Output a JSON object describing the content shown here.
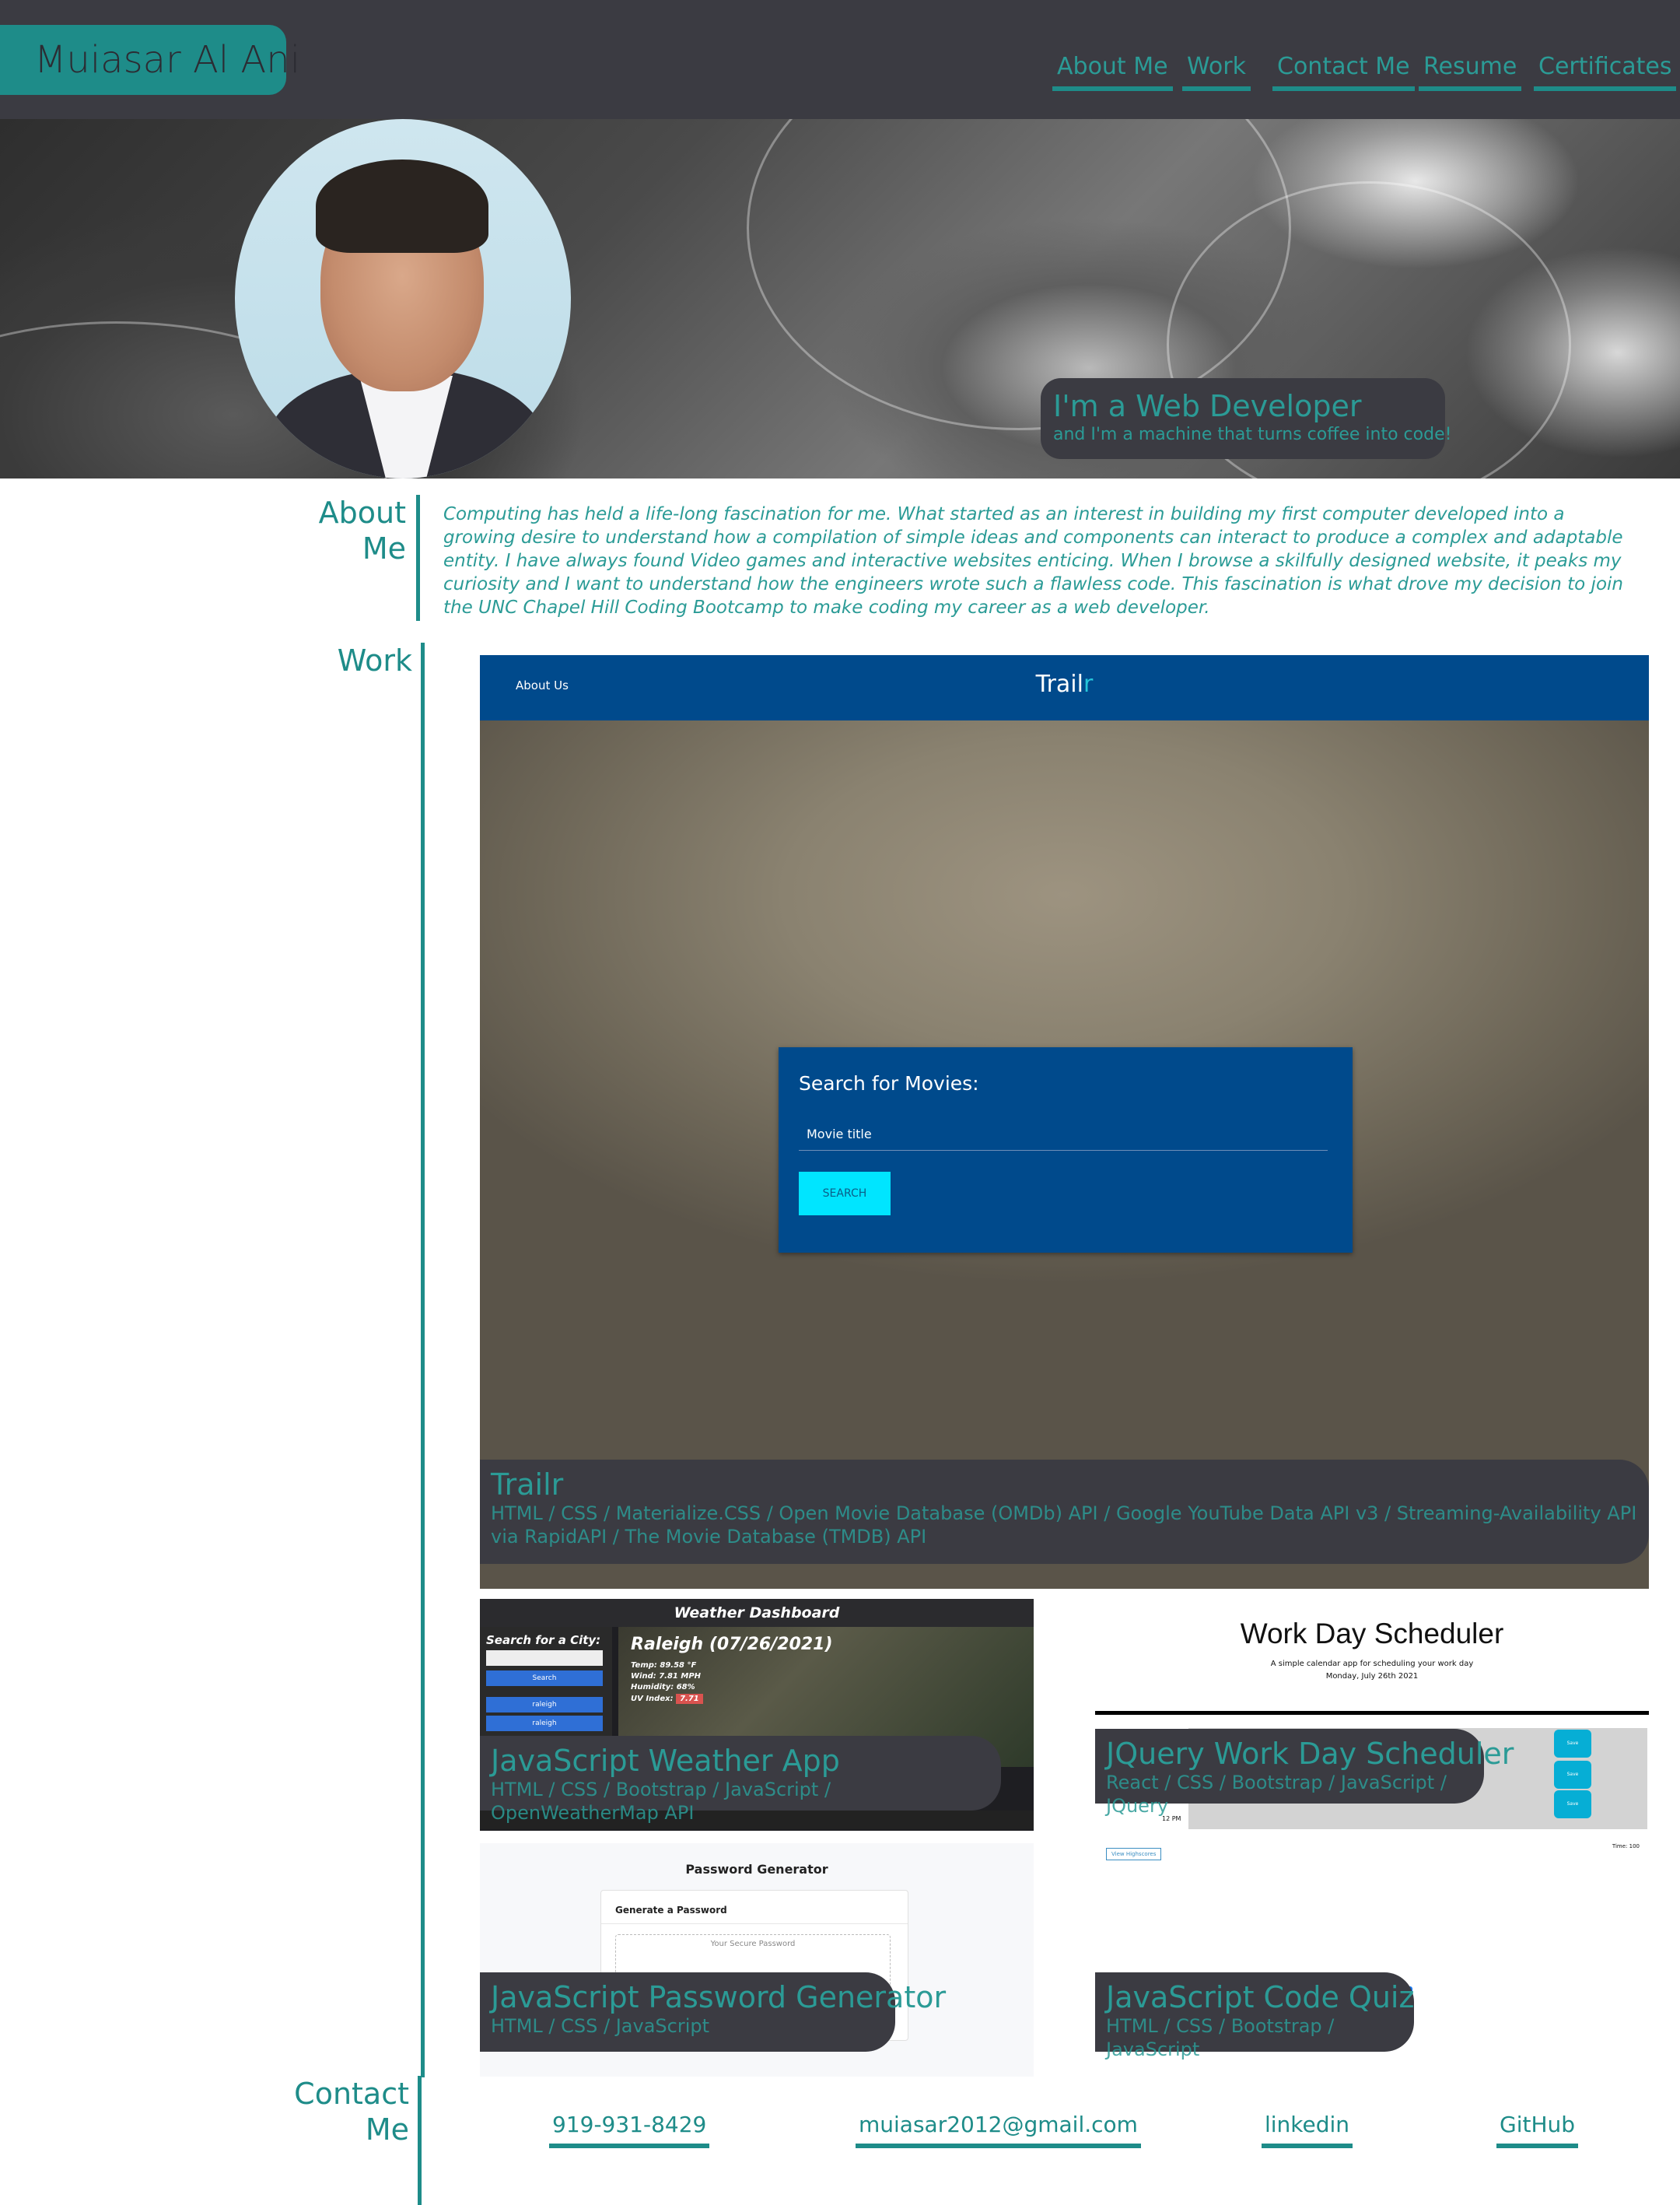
{
  "header": {
    "logo": "Muiasar Al Ani",
    "nav": [
      {
        "label": "About Me"
      },
      {
        "label": "Work"
      },
      {
        "label": "Contact Me"
      },
      {
        "label": "Resume"
      },
      {
        "label": "Certificates"
      }
    ]
  },
  "hero": {
    "title": "I'm a Web Developer",
    "subtitle": "and I'm a machine that turns coffee into code!"
  },
  "about": {
    "heading_line1": "About",
    "heading_line2": "Me",
    "text": "Computing has held a life-long fascination for me. What started as an interest in building my first computer developed into a growing desire to understand how a compilation of simple ideas and components can interact to produce a complex and adaptable entity. I have always found Video games and interactive websites enticing. When I browse a skilfully designed website, it peaks my curiosity and I want to understand how the engineers wrote such a flawless code. This fascination is what drove my decision to join the UNC Chapel Hill Coding Bootcamp to make coding my career as a web developer."
  },
  "work": {
    "heading": "Work",
    "projects": [
      {
        "title": "Trailr",
        "tech": "HTML / CSS / Materialize.CSS / Open Movie Database (OMDb) API / Google YouTube Data API v3 / Streaming-Availability API via RapidAPI / The Movie Database (TMDB) API",
        "preview": {
          "nav_link": "About Us",
          "brand_main": "Trail",
          "brand_accent": "r",
          "search_heading": "Search for Movies:",
          "search_placeholder": "Movie title",
          "search_button": "SEARCH"
        }
      },
      {
        "title": "JavaScript Weather App",
        "tech": "HTML / CSS / Bootstrap / JavaScript / OpenWeatherMap API",
        "preview": {
          "title": "Weather Dashboard",
          "search_label": "Search for a City:",
          "search_button": "Search",
          "history": [
            "raleigh",
            "raleigh",
            "raleigh"
          ],
          "city": "Raleigh (07/26/2021)",
          "temp": "Temp: 89.58 °F",
          "wind": "Wind: 7.81 MPH",
          "humidity": "Humidity: 68%",
          "uv_label": "UV Index:",
          "uv_value": "7.71"
        }
      },
      {
        "title": "JQuery Work Day Scheduler",
        "tech": "React / CSS / Bootstrap / JavaScript / JQuery",
        "preview": {
          "title": "Work Day Scheduler",
          "subtitle": "A simple calendar app for scheduling your work day",
          "date": "Monday, July 26th 2021",
          "hour_label": "12 PM",
          "save_label": "Save"
        }
      },
      {
        "title": "JavaScript Password Generator",
        "tech": "HTML / CSS / JavaScript",
        "preview": {
          "title": "Password Generator",
          "card_heading": "Generate a Password",
          "placeholder": "Your Secure Password"
        }
      },
      {
        "title": "JavaScript Code Quiz",
        "tech": "HTML / CSS / Bootstrap / JavaScript",
        "preview": {
          "highscores": "View Highscores",
          "timer": "Time: 100"
        }
      }
    ]
  },
  "contact": {
    "heading_line1": "Contact",
    "heading_line2": "Me",
    "phone": "919-931-8429",
    "email": "muiasar2012@gmail.com",
    "linkedin": "linkedin",
    "github": "GitHub"
  },
  "colors": {
    "accent": "#1e8c89",
    "dark": "#3b3b42",
    "trailr_blue": "#004a8c",
    "search_button": "#00e5ff"
  }
}
